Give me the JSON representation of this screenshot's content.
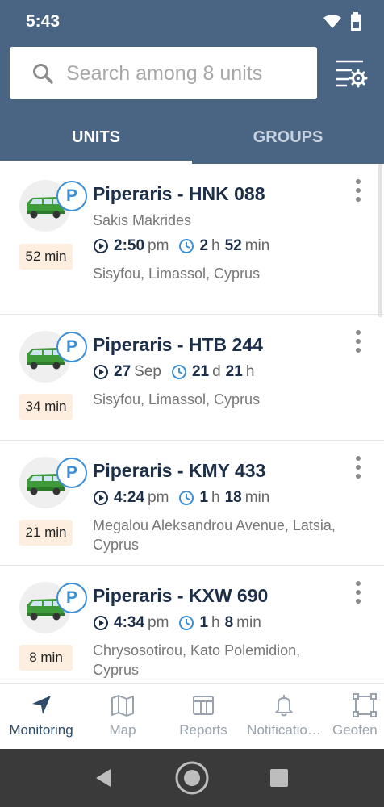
{
  "status_bar": {
    "time": "5:43",
    "icons": [
      "wifi-icon",
      "battery-icon"
    ]
  },
  "search": {
    "placeholder": "Search among 8 units",
    "value": ""
  },
  "tabs": [
    {
      "label": "UNITS",
      "active": true
    },
    {
      "label": "GROUPS",
      "active": false
    }
  ],
  "units": [
    {
      "name": "Piperaris - HNK 088",
      "driver": "Sakis Makrides",
      "time_value": "2:50",
      "time_unit": "pm",
      "dur_a": "2",
      "dur_a_unit": "h",
      "dur_b": "52",
      "dur_b_unit": "min",
      "address": "Sisyfou, Limassol, Cyprus",
      "badge": "52 min",
      "status_letter": "P"
    },
    {
      "name": "Piperaris - HTB 244",
      "driver": "",
      "time_value": "27",
      "time_unit": "Sep",
      "dur_a": "21",
      "dur_a_unit": "d",
      "dur_b": "21",
      "dur_b_unit": "h",
      "address": "Sisyfou, Limassol, Cyprus",
      "badge": "34 min",
      "status_letter": "P"
    },
    {
      "name": "Piperaris - KMY 433",
      "driver": "",
      "time_value": "4:24",
      "time_unit": "pm",
      "dur_a": "1",
      "dur_a_unit": "h",
      "dur_b": "18",
      "dur_b_unit": "min",
      "address": "Megalou Aleksandrou Avenue, Latsia, Cyprus",
      "badge": "21 min",
      "status_letter": "P"
    },
    {
      "name": "Piperaris - KXW 690",
      "driver": "",
      "time_value": "4:34",
      "time_unit": "pm",
      "dur_a": "1",
      "dur_a_unit": "h",
      "dur_b": "8",
      "dur_b_unit": "min",
      "address": "Chrysosotirou, Kato Polemidion, Cyprus",
      "badge": "8 min",
      "status_letter": "P"
    }
  ],
  "bottom_nav": [
    {
      "label": "Monitoring",
      "icon": "navigation-arrow-icon",
      "active": true
    },
    {
      "label": "Map",
      "icon": "map-icon",
      "active": false
    },
    {
      "label": "Reports",
      "icon": "reports-icon",
      "active": false
    },
    {
      "label": "Notificatio…",
      "icon": "bell-icon",
      "active": false
    },
    {
      "label": "Geofen",
      "icon": "geofence-icon",
      "active": false
    }
  ],
  "colors": {
    "header": "#4a6584",
    "accent_blue": "#3b8fd6",
    "badge_bg": "#fdeee0",
    "text_dark": "#1d2f48"
  }
}
